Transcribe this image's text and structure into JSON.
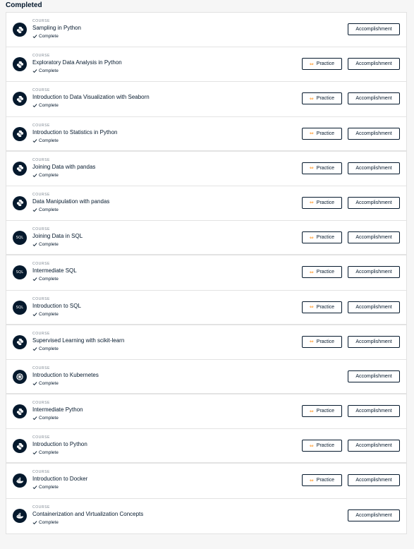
{
  "section": {
    "title": "Completed"
  },
  "labels": {
    "kind": "COURSE",
    "status": "Complete",
    "practice": "Practice",
    "accomplishment": "Accomplishment"
  },
  "courses": [
    {
      "title": "Sampling in Python",
      "icon": "python-icon",
      "practice": false
    },
    {
      "title": "Exploratory Data Analysis in Python",
      "icon": "python-icon",
      "practice": true
    },
    {
      "title": "Introduction to Data Visualization with Seaborn",
      "icon": "python-icon",
      "practice": true
    },
    {
      "title": "Introduction to Statistics in Python",
      "icon": "python-icon",
      "practice": true
    },
    {
      "title": "Joining Data with pandas",
      "icon": "python-icon",
      "practice": true
    },
    {
      "title": "Data Manipulation with pandas",
      "icon": "python-icon",
      "practice": true
    },
    {
      "title": "Joining Data in SQL",
      "icon": "sql-icon",
      "practice": true
    },
    {
      "title": "Intermediate SQL",
      "icon": "sql-icon",
      "practice": true
    },
    {
      "title": "Introduction to SQL",
      "icon": "sql-icon",
      "practice": true
    },
    {
      "title": "Supervised Learning with scikit-learn",
      "icon": "python-icon",
      "practice": true
    },
    {
      "title": "Introduction to Kubernetes",
      "icon": "kubernetes-icon",
      "practice": false
    },
    {
      "title": "Intermediate Python",
      "icon": "python-icon",
      "practice": true
    },
    {
      "title": "Introduction to Python",
      "icon": "python-icon",
      "practice": true
    },
    {
      "title": "Introduction to Docker",
      "icon": "docker-icon",
      "practice": true
    },
    {
      "title": "Containerization and Virtualization Concepts",
      "icon": "docker-icon",
      "practice": false
    }
  ],
  "icon_text": {
    "sql": "SQL"
  },
  "colors": {
    "badge": "#05192d",
    "practice_accent": "#ff931e",
    "text": "#05192d"
  }
}
